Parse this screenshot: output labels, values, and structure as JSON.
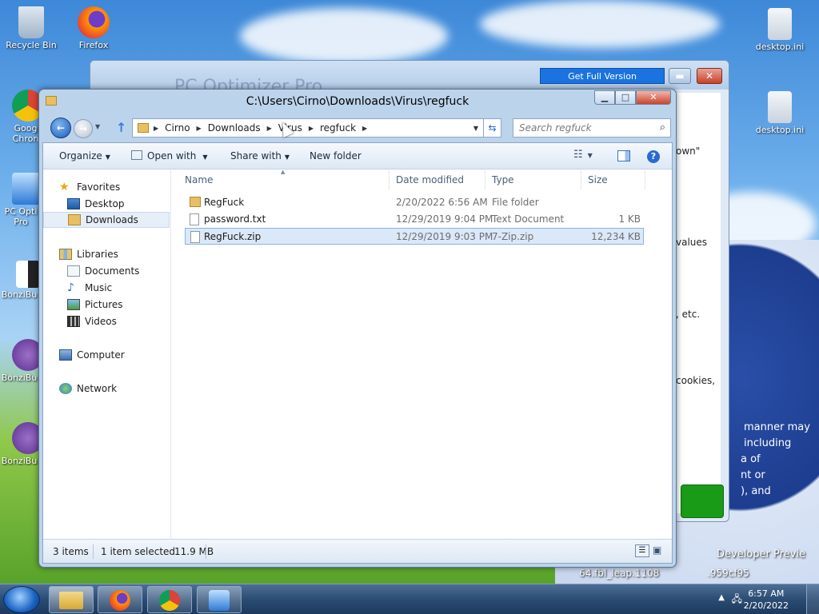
{
  "desktop": {
    "icons_left": [
      {
        "label": "Recycle Bin"
      },
      {
        "label": "Firefox"
      },
      {
        "label": "Goog Chron"
      },
      {
        "label": "PC Opti Pro"
      },
      {
        "label": "BonziBu"
      },
      {
        "label": "BonziBu"
      },
      {
        "label": "BonziBu"
      }
    ],
    "icons_right": [
      {
        "label": "desktop.ini"
      },
      {
        "label": "desktop.ini"
      }
    ],
    "wallpaper_text": {
      "line1": "Developer Previe",
      "line2": "64.fbl_leap.1108",
      "line3": ".959cf95"
    }
  },
  "optimizer": {
    "title": "PC Optimizer Pro",
    "get_full_label": "Get Full Version",
    "min_label": "▬",
    "close_label": "✕",
    "fragments": [
      "own\"",
      "values",
      ", etc.",
      "cookies,",
      "manner may",
      "including",
      "a of",
      "nt or",
      "), and"
    ]
  },
  "explorer": {
    "title": "C:\\Users\\Cirno\\Downloads\\Virus\\regfuck",
    "breadcrumb": [
      "Cirno",
      "Downloads",
      "Virus",
      "regfuck"
    ],
    "search_placeholder": "Search regfuck",
    "toolbar": {
      "organize": "Organize",
      "open_with": "Open with",
      "share_with": "Share with",
      "new_folder": "New folder"
    },
    "nav": {
      "favorites": "Favorites",
      "desktop": "Desktop",
      "downloads": "Downloads",
      "libraries": "Libraries",
      "documents": "Documents",
      "music": "Music",
      "pictures": "Pictures",
      "videos": "Videos",
      "computer": "Computer",
      "network": "Network"
    },
    "columns": {
      "name": "Name",
      "date": "Date modified",
      "type": "Type",
      "size": "Size"
    },
    "files": [
      {
        "name": "RegFuck",
        "date": "2/20/2022 6:56 AM",
        "type": "File folder",
        "size": ""
      },
      {
        "name": "password.txt",
        "date": "12/29/2019 9:04 PM",
        "type": "Text Document",
        "size": "1 KB"
      },
      {
        "name": "RegFuck.zip",
        "date": "12/29/2019 9:03 PM",
        "type": "7-Zip.zip",
        "size": "12,234 KB"
      }
    ],
    "status": {
      "count": "3 items",
      "selected": "1 item selected",
      "selected_size": "11.9 MB"
    }
  },
  "taskbar": {
    "time": "6:57 AM",
    "date": "2/20/2022"
  },
  "colors": {
    "accent": "#1a73e0",
    "selection": "#dbe8f8"
  }
}
